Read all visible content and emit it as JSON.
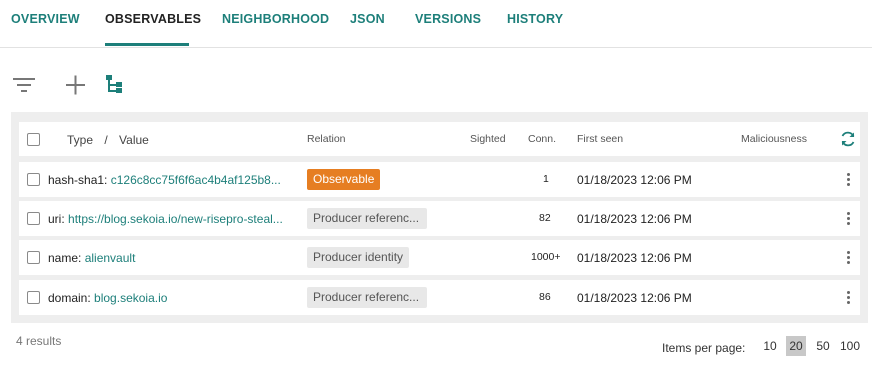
{
  "tabs": [
    {
      "label": "OVERVIEW"
    },
    {
      "label": "OBSERVABLES"
    },
    {
      "label": "NEIGHBORHOOD"
    },
    {
      "label": "JSON"
    },
    {
      "label": "VERSIONS"
    },
    {
      "label": "HISTORY"
    }
  ],
  "active_tab": "OBSERVABLES",
  "toolbar": {
    "filter_icon": "filter-icon",
    "add_icon": "plus-icon",
    "tree_icon": "tree-view-icon"
  },
  "table": {
    "headers": {
      "type": "Type",
      "separator": "/",
      "value": "Value",
      "relation": "Relation",
      "sighted": "Sighted",
      "conn": "Conn.",
      "first_seen": "First seen",
      "maliciousness": "Maliciousness"
    },
    "rows": [
      {
        "type": "hash-sha1:",
        "value": "c126c8cc75f6f6ac4b4af125b8...",
        "relation": "Observable",
        "conn": "1",
        "first_seen": "01/18/2023 12:06 PM"
      },
      {
        "type": "uri:",
        "value": "https://blog.sekoia.io/new-risepro-steal...",
        "relation": "Producer referenc...",
        "conn": "82",
        "first_seen": "01/18/2023 12:06 PM"
      },
      {
        "type": "name:",
        "value": "alienvault",
        "relation": "Producer identity",
        "conn": "1000+",
        "first_seen": "01/18/2023 12:06 PM"
      },
      {
        "type": "domain:",
        "value": "blog.sekoia.io",
        "relation": "Producer referenc...",
        "conn": "86",
        "first_seen": "01/18/2023 12:06 PM"
      }
    ]
  },
  "footer": {
    "results": "4 results",
    "items_per_page_label": "Items per page:",
    "page_sizes": [
      "10",
      "20",
      "50",
      "100"
    ],
    "selected_page_size": "20"
  },
  "colors": {
    "accent": "#1d7f7a",
    "observable_chip": "#e67e22",
    "chip_grey": "#e8e8e8",
    "table_bg": "#eeeeee"
  }
}
